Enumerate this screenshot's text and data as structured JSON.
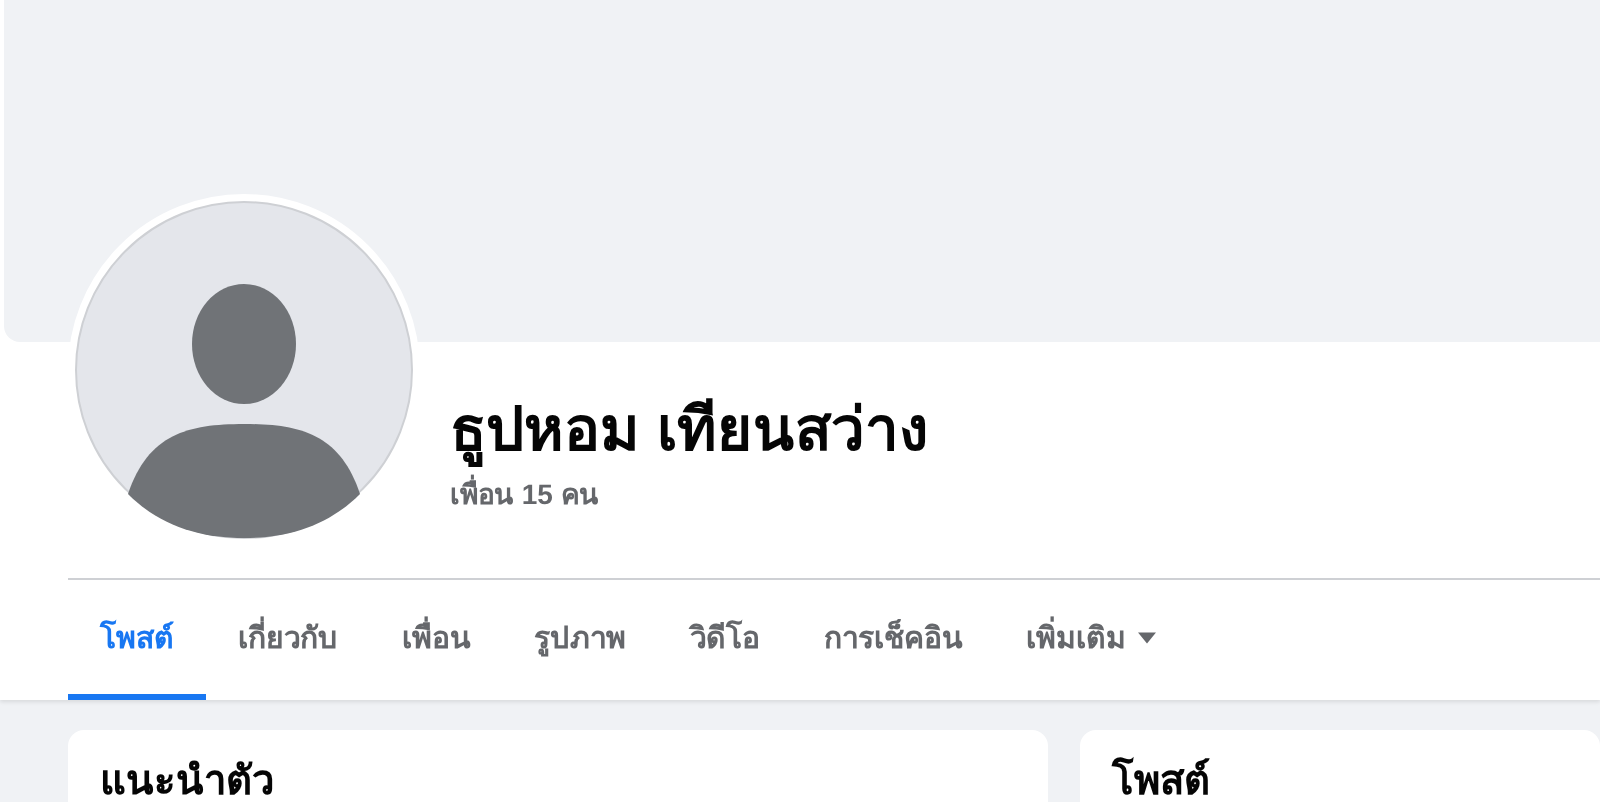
{
  "profile": {
    "name": "ธูปหอม เทียนสว่าง",
    "friends_count": "เพื่อน 15 คน"
  },
  "tabs": [
    {
      "label": "โพสต์",
      "selected": true,
      "kind": "tab"
    },
    {
      "label": "เกี่ยวกับ",
      "selected": false,
      "kind": "tab"
    },
    {
      "label": "เพื่อน",
      "selected": false,
      "kind": "tab"
    },
    {
      "label": "รูปภาพ",
      "selected": false,
      "kind": "tab"
    },
    {
      "label": "วิดีโอ",
      "selected": false,
      "kind": "tab"
    },
    {
      "label": "การเช็คอิน",
      "selected": false,
      "kind": "tab"
    },
    {
      "label": "เพิ่มเติม",
      "selected": false,
      "kind": "menu"
    }
  ],
  "cards": [
    {
      "title": "แนะนำตัว"
    },
    {
      "title": "โพสต์"
    }
  ]
}
